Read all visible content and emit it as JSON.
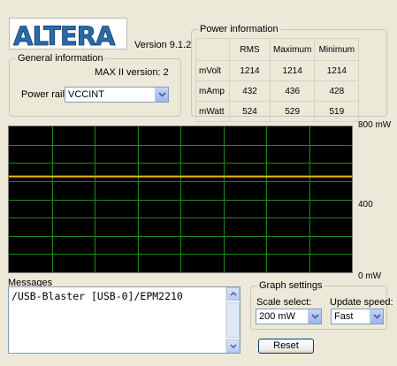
{
  "app": {
    "logo_text": "ALTERA",
    "version": "Version 9.1.2"
  },
  "general": {
    "title": "General information",
    "maxii": "MAX II version:  2",
    "rail_label": "Power rail:",
    "rail_value": "VCCINT"
  },
  "power": {
    "title": "Power information",
    "headers": [
      "RMS",
      "Maximum",
      "Minimum"
    ],
    "rows": [
      {
        "label": "mVolt",
        "rms": "1214",
        "max": "1214",
        "min": "1214"
      },
      {
        "label": "mAmp",
        "rms": "432",
        "max": "436",
        "min": "428"
      },
      {
        "label": "mWatt",
        "rms": "524",
        "max": "529",
        "min": "519"
      }
    ]
  },
  "graph": {
    "y_top": "800 mW",
    "y_mid": "400",
    "y_bottom": "0 mW",
    "y_max_mw": 800,
    "trace_rms_mw": 524,
    "trace_max_mw": 529,
    "colors": {
      "background": "#000000",
      "grid": "#1f8a1f",
      "trace_rms": "#ffff00",
      "trace_max": "#ff2020"
    }
  },
  "messages": {
    "label": "Messages",
    "text": "/USB-Blaster [USB-0]/EPM2210"
  },
  "graph_settings": {
    "title": "Graph settings",
    "scale_label": "Scale select:",
    "scale_value": "200 mW",
    "speed_label": "Update speed:",
    "speed_value": "Fast",
    "reset_label": "Reset"
  }
}
